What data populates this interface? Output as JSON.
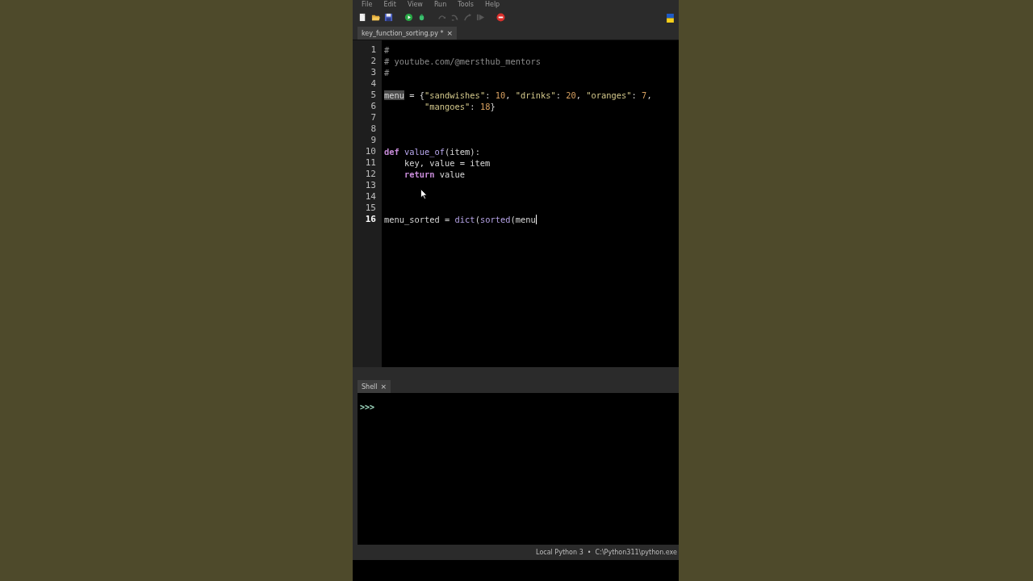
{
  "menu": [
    "File",
    "Edit",
    "View",
    "Run",
    "Tools",
    "Help"
  ],
  "toolbar": [
    {
      "kind": "new"
    },
    {
      "kind": "open"
    },
    {
      "kind": "save"
    },
    {
      "kind": "run"
    },
    {
      "kind": "debug"
    },
    {
      "kind": "step-over",
      "disabled": true
    },
    {
      "kind": "step-into",
      "disabled": true
    },
    {
      "kind": "step-out",
      "disabled": true
    },
    {
      "kind": "resume",
      "disabled": true
    },
    {
      "kind": "stop",
      "disabled": false
    }
  ],
  "editor_tabs": [
    {
      "label": "key_function_sorting.py *",
      "close": "×",
      "selected": true
    }
  ],
  "code_lines": [
    {
      "number": "1",
      "current": false,
      "caret": false,
      "tokens": [
        {
          "kind": "comment",
          "text": "#"
        }
      ]
    },
    {
      "number": "2",
      "current": false,
      "caret": false,
      "tokens": [
        {
          "kind": "comment",
          "text": "# youtube.com/@mersthub_mentors"
        }
      ]
    },
    {
      "number": "3",
      "current": false,
      "caret": false,
      "tokens": [
        {
          "kind": "comment",
          "text": "#"
        }
      ]
    },
    {
      "number": "4",
      "current": false,
      "caret": false
    },
    {
      "number": "5",
      "current": false,
      "caret": false,
      "tokens": [
        {
          "kind": "occurrence",
          "text": "menu"
        },
        {
          "kind": "plain",
          "text": " = {"
        },
        {
          "kind": "string",
          "text": "\"sandwishes\""
        },
        {
          "kind": "plain",
          "text": ": "
        },
        {
          "kind": "number",
          "text": "10"
        },
        {
          "kind": "plain",
          "text": ", "
        },
        {
          "kind": "string",
          "text": "\"drinks\""
        },
        {
          "kind": "plain",
          "text": ": "
        },
        {
          "kind": "number",
          "text": "20"
        },
        {
          "kind": "plain",
          "text": ", "
        },
        {
          "kind": "string",
          "text": "\"oranges\""
        },
        {
          "kind": "plain",
          "text": ": "
        },
        {
          "kind": "number",
          "text": "7"
        },
        {
          "kind": "plain",
          "text": ","
        }
      ]
    },
    {
      "number": "6",
      "current": false,
      "caret": false,
      "tokens": [
        {
          "kind": "string",
          "text": "        \"mangoes\""
        },
        {
          "kind": "plain",
          "text": ": "
        },
        {
          "kind": "number",
          "text": "18"
        },
        {
          "kind": "plain",
          "text": "}"
        }
      ]
    },
    {
      "number": "7",
      "current": false,
      "caret": false
    },
    {
      "number": "8",
      "current": false,
      "caret": false
    },
    {
      "number": "9",
      "current": false,
      "caret": false
    },
    {
      "number": "10",
      "current": false,
      "caret": false,
      "tokens": [
        {
          "kind": "keyword",
          "text": "def"
        },
        {
          "kind": "definition",
          "text": " value_of"
        },
        {
          "kind": "plain",
          "text": "(item):"
        }
      ]
    },
    {
      "number": "11",
      "current": false,
      "caret": false,
      "tokens": [
        {
          "kind": "plain",
          "text": "    key, value = item"
        }
      ]
    },
    {
      "number": "12",
      "current": false,
      "caret": false,
      "tokens": [
        {
          "kind": "keyword",
          "text": "    return"
        },
        {
          "kind": "plain",
          "text": " value"
        }
      ]
    },
    {
      "number": "13",
      "current": false,
      "caret": false
    },
    {
      "number": "14",
      "current": false,
      "caret": false
    },
    {
      "number": "15",
      "current": false,
      "caret": false
    },
    {
      "number": "16",
      "current": true,
      "caret": true,
      "tokens": [
        {
          "kind": "plain",
          "text": "menu_sorted = "
        },
        {
          "kind": "builtin",
          "text": "dict"
        },
        {
          "kind": "plain",
          "text": "("
        },
        {
          "kind": "builtin",
          "text": "sorted"
        },
        {
          "kind": "plain",
          "text": "(menu"
        }
      ]
    }
  ],
  "shell_tabs": [
    {
      "label": "Shell",
      "close": "×",
      "selected": true
    }
  ],
  "shell": {
    "prompt": ">>>"
  },
  "status_bar": {
    "interpreter": "Local Python 3  •  C:\\Python311\\python.exe"
  }
}
